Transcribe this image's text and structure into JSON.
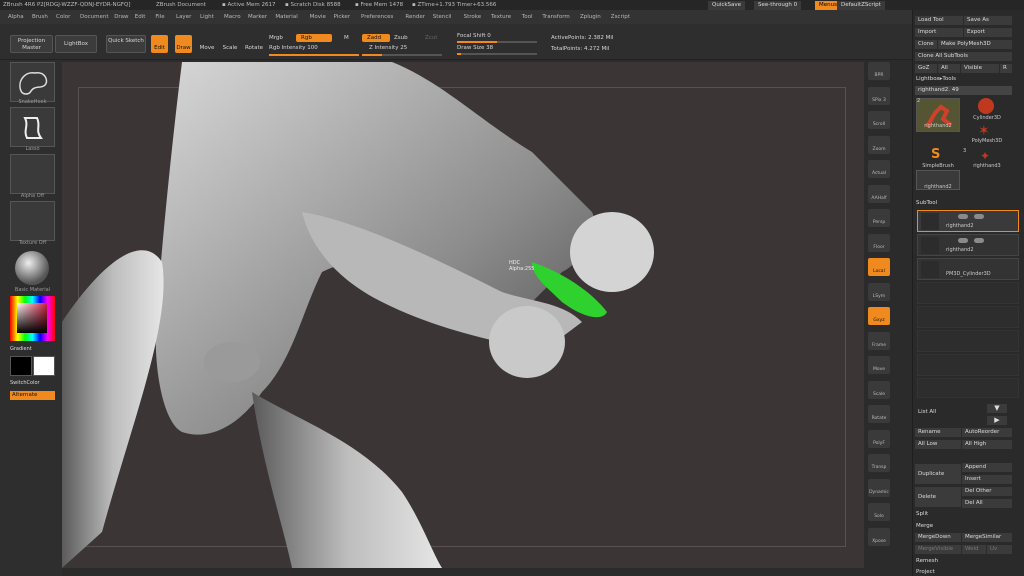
{
  "titlebar": {
    "app": "ZBrush 4R6 P2[RDGJ-WZZF-QDNJ-EYDR-NGFQ]",
    "doc": "ZBrush Document",
    "active_mem": "▪ Active Mem 2617",
    "scratch": "▪ Scratch Disk 8588",
    "free_mem": "▪ Free Mem 1478",
    "ztime": "▪ ZTime+1.793 Timer+63.566"
  },
  "menus": [
    "Alpha",
    "Brush",
    "Color",
    "Document",
    "Draw",
    "Edit",
    "File",
    "Layer",
    "Light",
    "Macro",
    "Marker",
    "Material",
    "Movie",
    "Picker",
    "Preferences",
    "Render",
    "Stencil",
    "Stroke",
    "Texture",
    "Tool",
    "Transform",
    "Zplugin",
    "Zscript"
  ],
  "quickbar": {
    "quicksave": "QuickSave",
    "seethrough": "See-through",
    "seethrough_value": "0",
    "menus": "Menus",
    "script": "DefaultZScript"
  },
  "toolbar": {
    "projection_master": "Projection Master",
    "lightbox": "LightBox",
    "quick_sketch": "Quick Sketch",
    "edit": "Edit",
    "draw": "Draw",
    "move": "Move",
    "scale": "Scale",
    "rotate": "Rotate",
    "mrgb": "Mrgb",
    "rgb": "Rgb",
    "m": "M",
    "rgb_intensity_label": "Rgb Intensity",
    "rgb_intensity": "100",
    "rgb_intensity_fraction": 1.0,
    "zadd": "Zadd",
    "zsub": "Zsub",
    "zcut": "Zcut",
    "z_intensity_label": "Z Intensity",
    "z_intensity": "25",
    "z_intensity_fraction": 0.25,
    "focal_shift_label": "Focal Shift",
    "focal_shift": "0",
    "focal_shift_fraction": 0.5,
    "draw_size_label": "Draw Size",
    "draw_size": "38",
    "draw_size_fraction": 0.05,
    "active_points": "ActivePoints: 2.382 Mil",
    "total_points": "TotalPoints: 4.272 Mil"
  },
  "leftshelf": {
    "brush_caption": "SnakeHook",
    "stroke_caption": "Lasso",
    "alpha_caption": "Alpha Off",
    "texture_caption": "Texture Off",
    "material_caption": "Basic Material",
    "gradient": "Gradient",
    "switch_color": "SwitchColor",
    "alternate": "Alternate"
  },
  "canvas": {
    "tooltip_line1": "HDC",
    "tooltip_line2": "Alpha:255"
  },
  "rightshelf": [
    "BPR",
    "SPix 3",
    "Scroll",
    "Zoom",
    "Actual",
    "AAHalf",
    "Persp",
    "Floor",
    "Local",
    "LSym",
    "Gxyz",
    "Frame",
    "Move",
    "Scale",
    "Rotate",
    "PolyF",
    "Transp",
    "Dynamic",
    "Solo",
    "Xpose"
  ],
  "rpanel": {
    "load_tool": "Load Tool",
    "save_as": "Save As",
    "import": "Import",
    "export": "Export",
    "clone": "Clone",
    "make_polymesh": "Make PolyMesh3D",
    "clone_all": "Clone All SubTools",
    "goz": "GoZ",
    "all": "All",
    "visible": "Visible",
    "r": "R",
    "lightbox_tools": "Lightbox▸Tools",
    "current_tool": "righthand2. 49",
    "tool_count_1": "2",
    "tool_count_2": "3",
    "tools": [
      "righthand2",
      "Cylinder3D",
      "PolyMesh3D",
      "SimpleBrush",
      "righthand3",
      "righthand2"
    ],
    "subtool_header": "SubTool",
    "subtools": [
      "righthand2",
      "righthand2",
      "PM3D_Cylinder3D"
    ],
    "list_all": "List All",
    "rename": "Rename",
    "auto_reorder": "AutoReorder",
    "all_low": "All Low",
    "all_high": "All High",
    "duplicate": "Duplicate",
    "append": "Append",
    "insert": "Insert",
    "delete": "Delete",
    "del_other": "Del Other",
    "del_all": "Del All",
    "split": "Split",
    "merge": "Merge",
    "merge_down": "MergeDown",
    "merge_similar": "MergeSimilar",
    "merge_visible": "MergeVisible",
    "weld": "Weld",
    "uv": "Uv",
    "remesh": "Remesh",
    "project": "Project"
  },
  "colors": {
    "accent": "#f08a1e",
    "canvas_bg": "#3c3536",
    "panel_bg": "#2a2a2a"
  }
}
